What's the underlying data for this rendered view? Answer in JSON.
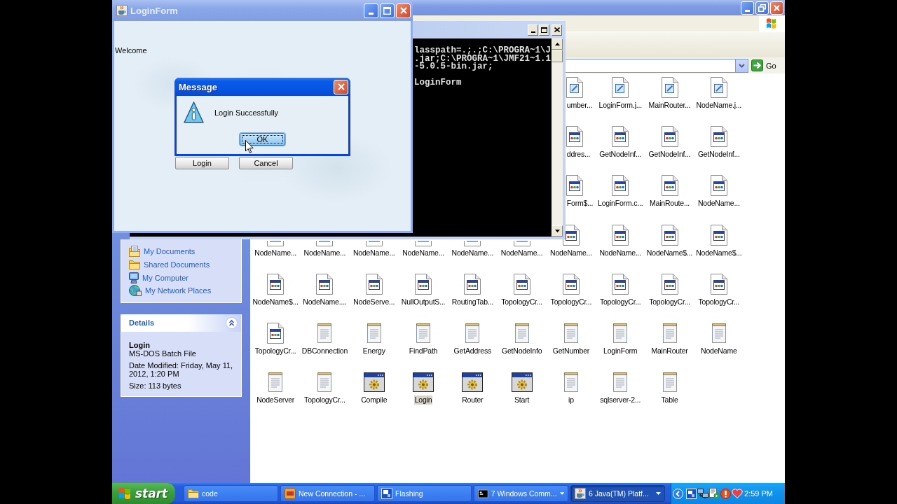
{
  "explorer": {
    "go_label": "Go",
    "places": [
      {
        "label": "My Documents",
        "kind": "documents"
      },
      {
        "label": "Shared Documents",
        "kind": "folder"
      },
      {
        "label": "My Computer",
        "kind": "computer"
      },
      {
        "label": "My Network Places",
        "kind": "network"
      }
    ],
    "details": {
      "title": "Details",
      "expanded": true,
      "name": "Login",
      "type": "MS-DOS Batch File",
      "modified": "Date Modified: Friday, May 11, 2012, 1:20 PM",
      "size": "Size: 113 bytes"
    },
    "file_rows": [
      {
        "covered": true,
        "files": [
          {
            "name": "umber...",
            "kind": "java",
            "selected": false
          },
          {
            "name": "LoginForm.j...",
            "kind": "java",
            "selected": false
          },
          {
            "name": "MainRouter...",
            "kind": "java",
            "selected": false
          },
          {
            "name": "NodeName.j...",
            "kind": "java",
            "selected": false
          }
        ]
      },
      {
        "covered": true,
        "files": [
          {
            "name": "ddres...",
            "kind": "class",
            "selected": false
          },
          {
            "name": "GetNodeInf...",
            "kind": "class",
            "selected": false
          },
          {
            "name": "GetNodeInf...",
            "kind": "class",
            "selected": false
          },
          {
            "name": "GetNodeInf...",
            "kind": "class",
            "selected": false
          }
        ]
      },
      {
        "covered": true,
        "files": [
          {
            "name": "Form$...",
            "kind": "class",
            "selected": false
          },
          {
            "name": "LoginForm.c...",
            "kind": "class",
            "selected": false
          },
          {
            "name": "MainRoute...",
            "kind": "class",
            "selected": false
          },
          {
            "name": "NodeName...",
            "kind": "class",
            "selected": false
          }
        ]
      },
      {
        "covered": false,
        "files": [
          {
            "name": "NodeName...",
            "kind": "class",
            "selected": false,
            "icon_covered": true
          },
          {
            "name": "NodeName...",
            "kind": "class",
            "selected": false,
            "icon_covered": true
          },
          {
            "name": "NodeName...",
            "kind": "class",
            "selected": false,
            "icon_covered": true
          },
          {
            "name": "NodeName...",
            "kind": "class",
            "selected": false,
            "icon_covered": true
          },
          {
            "name": "NodeName...",
            "kind": "class",
            "selected": false,
            "icon_covered": true
          },
          {
            "name": "NodeName...",
            "kind": "class",
            "selected": false,
            "icon_covered": true
          },
          {
            "name": "NodeName...",
            "kind": "class",
            "selected": false,
            "icon_covered": false
          },
          {
            "name": "NodeName...",
            "kind": "class",
            "selected": false,
            "icon_covered": false
          },
          {
            "name": "NodeName$...",
            "kind": "class",
            "selected": false,
            "icon_covered": false
          },
          {
            "name": "NodeName$...",
            "kind": "class",
            "selected": false,
            "icon_covered": false
          }
        ]
      },
      {
        "covered": false,
        "files": [
          {
            "name": "NodeName$...",
            "kind": "class",
            "selected": false
          },
          {
            "name": "NodeName....",
            "kind": "class",
            "selected": false
          },
          {
            "name": "NodeServe...",
            "kind": "class",
            "selected": false
          },
          {
            "name": "NullOutputS...",
            "kind": "class",
            "selected": false
          },
          {
            "name": "RoutingTab...",
            "kind": "class",
            "selected": false
          },
          {
            "name": "TopologyCr...",
            "kind": "class",
            "selected": false
          },
          {
            "name": "TopologyCr...",
            "kind": "class",
            "selected": false
          },
          {
            "name": "TopologyCr...",
            "kind": "class",
            "selected": false
          },
          {
            "name": "TopologyCr...",
            "kind": "class",
            "selected": false
          },
          {
            "name": "TopologyCr...",
            "kind": "class",
            "selected": false
          }
        ]
      },
      {
        "covered": false,
        "files": [
          {
            "name": "TopologyCr...",
            "kind": "class",
            "selected": false
          },
          {
            "name": "DBConnection",
            "kind": "text",
            "selected": false
          },
          {
            "name": "Energy",
            "kind": "text",
            "selected": false
          },
          {
            "name": "FindPath",
            "kind": "text",
            "selected": false
          },
          {
            "name": "GetAddress",
            "kind": "text",
            "selected": false
          },
          {
            "name": "GetNodeInfo",
            "kind": "text",
            "selected": false
          },
          {
            "name": "GetNumber",
            "kind": "text",
            "selected": false
          },
          {
            "name": "LoginForm",
            "kind": "text",
            "selected": false
          },
          {
            "name": "MainRouter",
            "kind": "text",
            "selected": false
          },
          {
            "name": "NodeName",
            "kind": "text",
            "selected": false
          }
        ]
      },
      {
        "covered": false,
        "files": [
          {
            "name": "NodeServer",
            "kind": "text",
            "selected": false
          },
          {
            "name": "TopologyCr...",
            "kind": "text",
            "selected": false
          },
          {
            "name": "Compile",
            "kind": "batch",
            "selected": false
          },
          {
            "name": "Login",
            "kind": "batch",
            "selected": true
          },
          {
            "name": "Router",
            "kind": "batch",
            "selected": false
          },
          {
            "name": "Start",
            "kind": "batch",
            "selected": false
          },
          {
            "name": "ip",
            "kind": "text",
            "selected": false
          },
          {
            "name": "sqlserver-2...",
            "kind": "text",
            "selected": false
          },
          {
            "name": "Table",
            "kind": "text",
            "selected": false
          }
        ]
      }
    ]
  },
  "console": {
    "blocks": [
      [
        "lasspath=.;.;C:\\PROGRA~1\\J",
        ".jar;C:\\PROGRA~1\\JMF21~1.1",
        "-5.0.5-bin.jar;"
      ],
      [
        "LoginForm"
      ]
    ]
  },
  "login_form": {
    "title": "LoginForm",
    "welcome": "Welcome",
    "buttons": [
      "Login",
      "Cancel"
    ]
  },
  "message": {
    "title": "Message",
    "text": "Login Successfully",
    "button": {
      "label": "OK",
      "focused": true
    }
  },
  "taskbar": {
    "start": "start",
    "tasks": [
      {
        "label": "code",
        "kind": "folder",
        "grouped": false,
        "selected": false
      },
      {
        "label": "New Connection - ...",
        "kind": "app",
        "grouped": false,
        "selected": false
      },
      {
        "label": "Flashing",
        "kind": "window",
        "grouped": false,
        "selected": false
      },
      {
        "label": "7 Windows Comm...",
        "kind": "console",
        "grouped": true,
        "selected": false
      },
      {
        "label": "6 Java(TM) Platf...",
        "kind": "java",
        "grouped": true,
        "selected": true
      }
    ],
    "clock": "2:59 PM"
  }
}
